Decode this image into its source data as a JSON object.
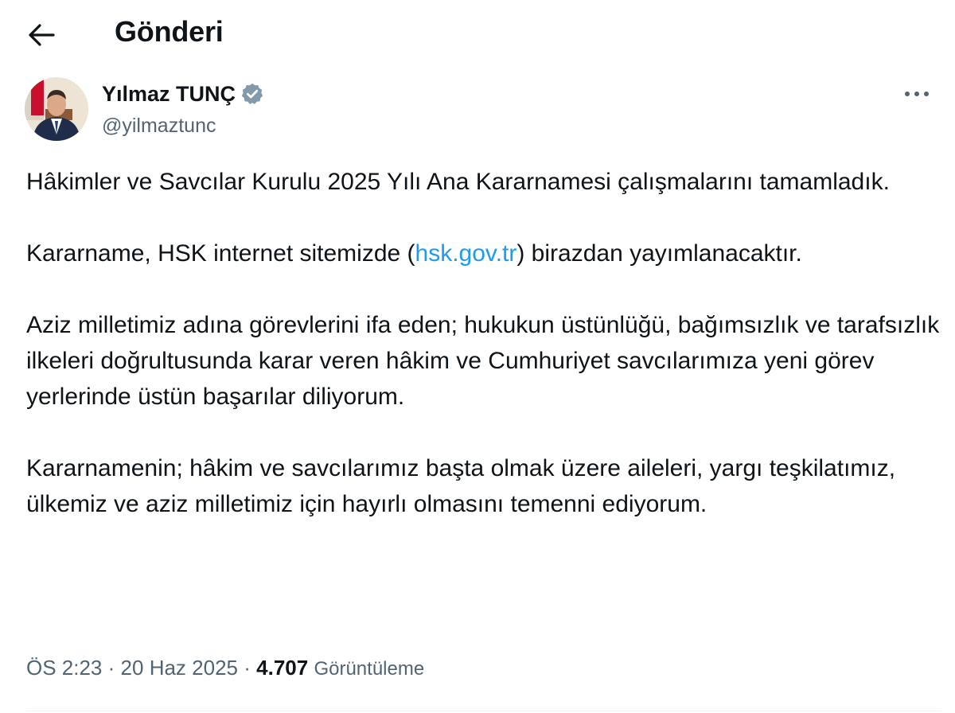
{
  "header": {
    "title": "Gönderi",
    "back_icon": "arrow-left-icon"
  },
  "author": {
    "name": "Yılmaz TUNÇ",
    "handle": "@yilmaztunc",
    "verified_icon": "verified-badge-icon",
    "more_icon": "more-horizontal-icon"
  },
  "tweet": {
    "p1": "Hâkimler ve Savcılar Kurulu 2025 Yılı Ana Kararnamesi çalışmalarını tamamladık.",
    "p2_before": "Kararname, HSK internet sitemizde (",
    "p2_link": "hsk.gov.tr",
    "p2_after": ") birazdan yayımlanacaktır.",
    "p3": "Aziz milletimiz adına görevlerini ifa eden; hukukun üstünlüğü, bağımsızlık ve tarafsızlık ilkeleri doğrultusunda karar veren hâkim ve Cumhuriyet savcılarımıza yeni görev yerlerinde üstün başarılar diliyorum.",
    "p4": "Kararnamenin; hâkim ve savcılarımız başta olmak üzere aileleri, yargı teşkilatımız, ülkemiz ve aziz milletimiz için hayırlı olmasını temenni ediyorum."
  },
  "meta": {
    "time": "ÖS 2:23",
    "separator": "·",
    "date": "20 Haz 2025",
    "views_count": "4.707",
    "views_label": "Görüntüleme"
  },
  "colors": {
    "text": "#0f1419",
    "secondary": "#536471",
    "link": "#1d9bf0",
    "verified": "#829aab"
  }
}
